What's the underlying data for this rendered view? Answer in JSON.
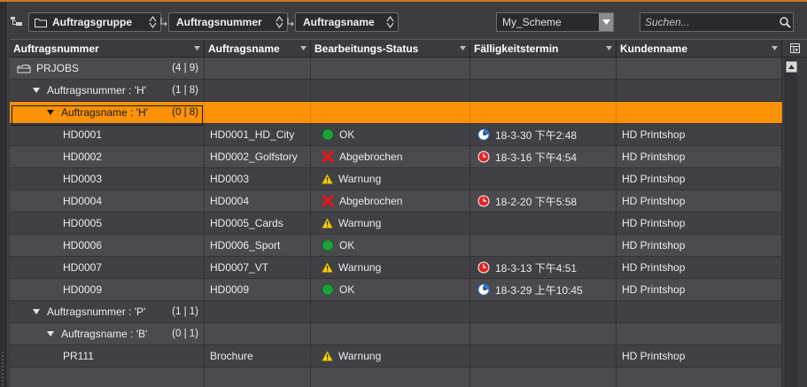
{
  "toolbar": {
    "chips": [
      {
        "label": "Auftragsgruppe"
      },
      {
        "label": "Auftragsnummer"
      },
      {
        "label": "Auftragsname"
      }
    ],
    "scheme_value": "My_Scheme",
    "search_placeholder": "Suchen..."
  },
  "columns": [
    "Auftragsnummer",
    "Auftragsname",
    "Bearbeitungs-Status",
    "Fälligkeitstermin",
    "Kundenname"
  ],
  "rows": [
    {
      "type": "root",
      "label": "PRJOBS",
      "count": "(4 | 9)"
    },
    {
      "type": "group",
      "label": "Auftragsnummer : 'H'",
      "count": "(1 | 8)"
    },
    {
      "type": "subgroup",
      "label": "Auftragsname : 'H'",
      "count": "(0 | 8)",
      "selected": true
    },
    {
      "type": "job",
      "number": "HD0001",
      "name": "HD0001_HD_City",
      "status": "OK",
      "status_icon": "ok-icon",
      "due": "18-3-30 下午2:48",
      "due_icon": "clock-blue-icon",
      "customer": "HD Printshop"
    },
    {
      "type": "job",
      "number": "HD0002",
      "name": "HD0002_Golfstory",
      "status": "Abgebrochen",
      "status_icon": "cancel-icon",
      "due": "18-3-16 下午4:54",
      "due_icon": "clock-red-icon",
      "customer": "HD Printshop"
    },
    {
      "type": "job",
      "number": "HD0003",
      "name": "HD0003",
      "status": "Warnung",
      "status_icon": "warning-icon",
      "due": "",
      "due_icon": "",
      "customer": "HD Printshop"
    },
    {
      "type": "job",
      "number": "HD0004",
      "name": "HD0004",
      "status": "Abgebrochen",
      "status_icon": "cancel-icon",
      "due": "18-2-20 下午5:58",
      "due_icon": "clock-red-icon",
      "customer": "HD Printshop"
    },
    {
      "type": "job",
      "number": "HD0005",
      "name": "HD0005_Cards",
      "status": "Warnung",
      "status_icon": "warning-icon",
      "due": "",
      "due_icon": "",
      "customer": "HD Printshop"
    },
    {
      "type": "job",
      "number": "HD0006",
      "name": "HD0006_Sport",
      "status": "OK",
      "status_icon": "ok-icon",
      "due": "",
      "due_icon": "",
      "customer": "HD Printshop"
    },
    {
      "type": "job",
      "number": "HD0007",
      "name": "HD0007_VT",
      "status": "Warnung",
      "status_icon": "warning-icon",
      "due": "18-3-13 下午4:51",
      "due_icon": "clock-red-icon",
      "customer": "HD Printshop"
    },
    {
      "type": "job",
      "number": "HD0009",
      "name": "HD0009",
      "status": "OK",
      "status_icon": "ok-icon",
      "due": "18-3-29 上午10:45",
      "due_icon": "clock-blue-icon",
      "customer": "HD Printshop"
    },
    {
      "type": "group",
      "label": "Auftragsnummer : 'P'",
      "count": "(1 | 1)"
    },
    {
      "type": "subgroup",
      "label": "Auftragsname : 'B'",
      "count": "(0 | 1)"
    },
    {
      "type": "job",
      "number": "PR111",
      "name": "Brochure",
      "status": "Warnung",
      "status_icon": "warning-icon",
      "due": "",
      "due_icon": "",
      "customer": "HD Printshop"
    },
    {
      "type": "empty"
    }
  ],
  "colors": {
    "accent": "#fb9208",
    "ok": "#1ea03a",
    "cancel": "#e01818",
    "warning": "#f5d000"
  }
}
